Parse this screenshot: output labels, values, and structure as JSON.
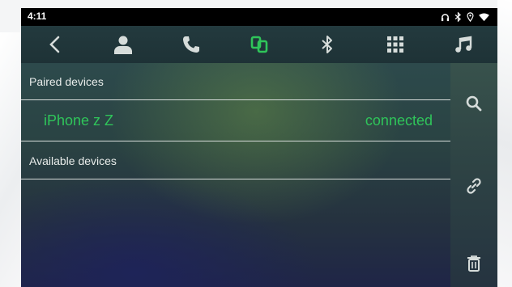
{
  "status_bar": {
    "time": "4:11",
    "icons": [
      "headphones-icon",
      "bluetooth-icon",
      "location-icon",
      "wifi-icon"
    ]
  },
  "nav": {
    "items": [
      {
        "name": "back",
        "icon": "chevron-left-icon",
        "active": false
      },
      {
        "name": "contacts",
        "icon": "person-icon",
        "active": false
      },
      {
        "name": "phone",
        "icon": "phone-icon",
        "active": false
      },
      {
        "name": "devices",
        "icon": "devices-icon",
        "active": true
      },
      {
        "name": "bluetooth",
        "icon": "bluetooth-icon",
        "active": false
      },
      {
        "name": "dialpad",
        "icon": "dialpad-icon",
        "active": false
      },
      {
        "name": "music",
        "icon": "music-note-icon",
        "active": false
      }
    ]
  },
  "sections": {
    "paired_label": "Paired devices",
    "available_label": "Available devices"
  },
  "paired_devices": [
    {
      "name": "iPhone z Z",
      "status": "connected"
    }
  ],
  "side_actions": [
    "search-icon",
    "link-icon",
    "trash-icon"
  ],
  "colors": {
    "accent": "#2fc55a",
    "text": "#e8ecea",
    "icon": "#d6dcda"
  }
}
